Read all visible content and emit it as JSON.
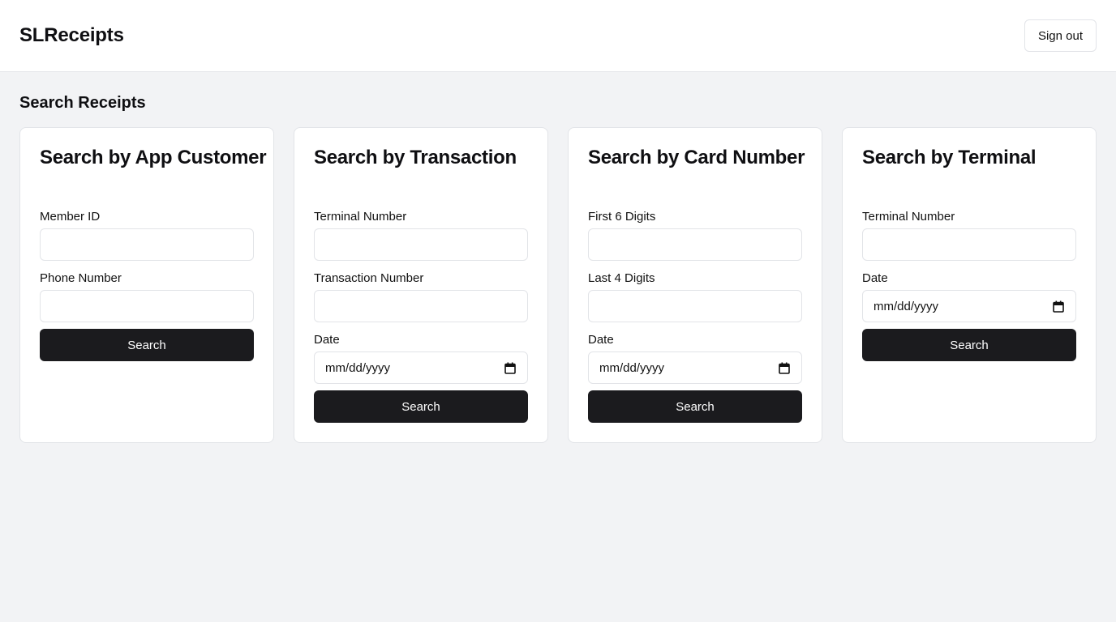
{
  "app": {
    "title": "SLReceipts",
    "sign_out_label": "Sign out"
  },
  "page": {
    "title": "Search Receipts"
  },
  "cards": [
    {
      "title": "Search by App Customer",
      "fields": [
        {
          "label": "Member ID",
          "value": ""
        },
        {
          "label": "Phone Number",
          "value": ""
        }
      ],
      "button": "Search"
    },
    {
      "title": "Search by Transaction",
      "fields": [
        {
          "label": "Terminal Number",
          "value": ""
        },
        {
          "label": "Transaction Number",
          "value": ""
        },
        {
          "label": "Date",
          "value": "mm/dd/yyyy"
        }
      ],
      "button": "Search"
    },
    {
      "title": "Search by Card Number",
      "fields": [
        {
          "label": "First 6 Digits",
          "value": ""
        },
        {
          "label": "Last 4 Digits",
          "value": ""
        },
        {
          "label": "Date",
          "value": "mm/dd/yyyy"
        }
      ],
      "button": "Search"
    },
    {
      "title": "Search by Terminal",
      "fields": [
        {
          "label": "Terminal Number",
          "value": ""
        },
        {
          "label": "Date",
          "value": "mm/dd/yyyy"
        }
      ],
      "button": "Search"
    }
  ],
  "icons": {
    "date_picker": "calendar-icon"
  },
  "colors": {
    "primary_button": "#1b1b1e",
    "background": "#f2f3f5"
  }
}
